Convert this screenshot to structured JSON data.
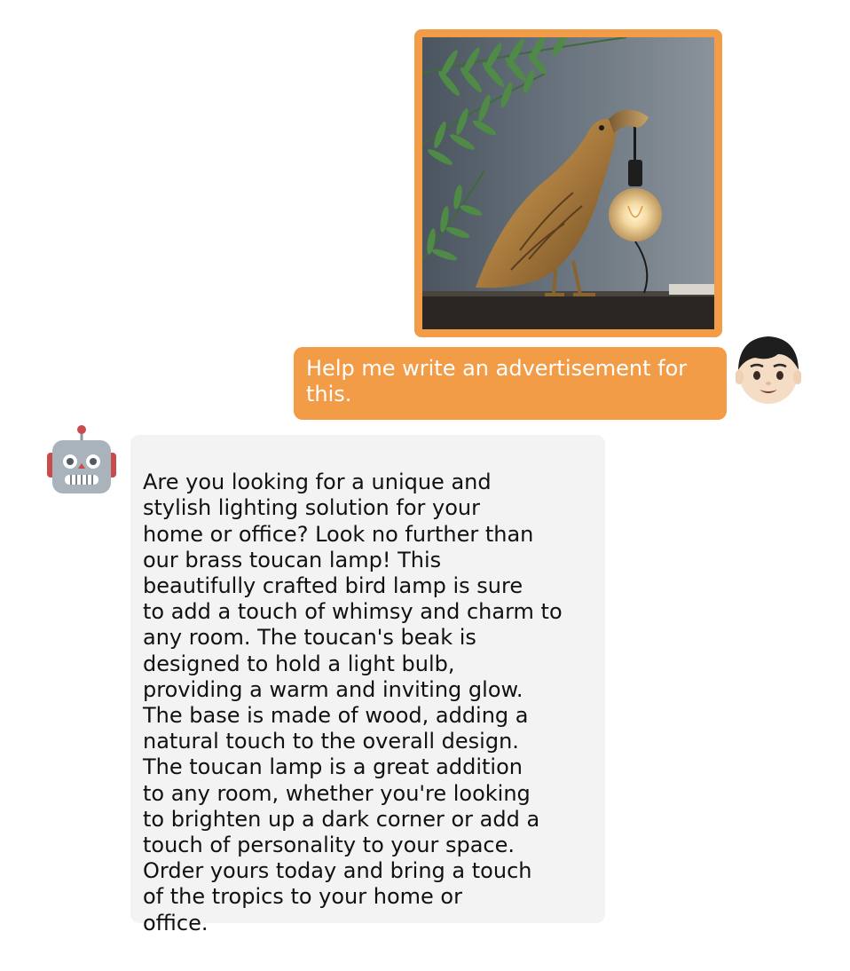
{
  "conversation": {
    "user_image": {
      "subject": "brass toucan table lamp holding a glowing bulb beside fern leaves"
    },
    "user_message": "Help me write an advertisement for this.",
    "bot_message": "Are you looking for a unique and\nstylish lighting solution for your\nhome or office? Look no further than\nour brass toucan lamp! This\nbeautifully crafted bird lamp is sure\nto add a touch of whimsy and charm to\nany room. The toucan's beak is\ndesigned to hold a light bulb,\nproviding a warm and inviting glow.\nThe base is made of wood, adding a\nnatural touch to the overall design.\nThe toucan lamp is a great addition\nto any room, whether you're looking\nto brighten up a dark corner or add a\ntouch of personality to your space.\nOrder yours today and bring a touch\nof the tropics to your home or\noffice."
  },
  "theme": {
    "user_bubble_color": "#F39C47",
    "bot_bubble_color": "#F3F3F3",
    "user_text_color": "#FFFFFF",
    "bot_text_color": "#111111"
  },
  "icons": {
    "user_avatar": "boy-face-icon",
    "bot_avatar": "robot-face-icon"
  }
}
